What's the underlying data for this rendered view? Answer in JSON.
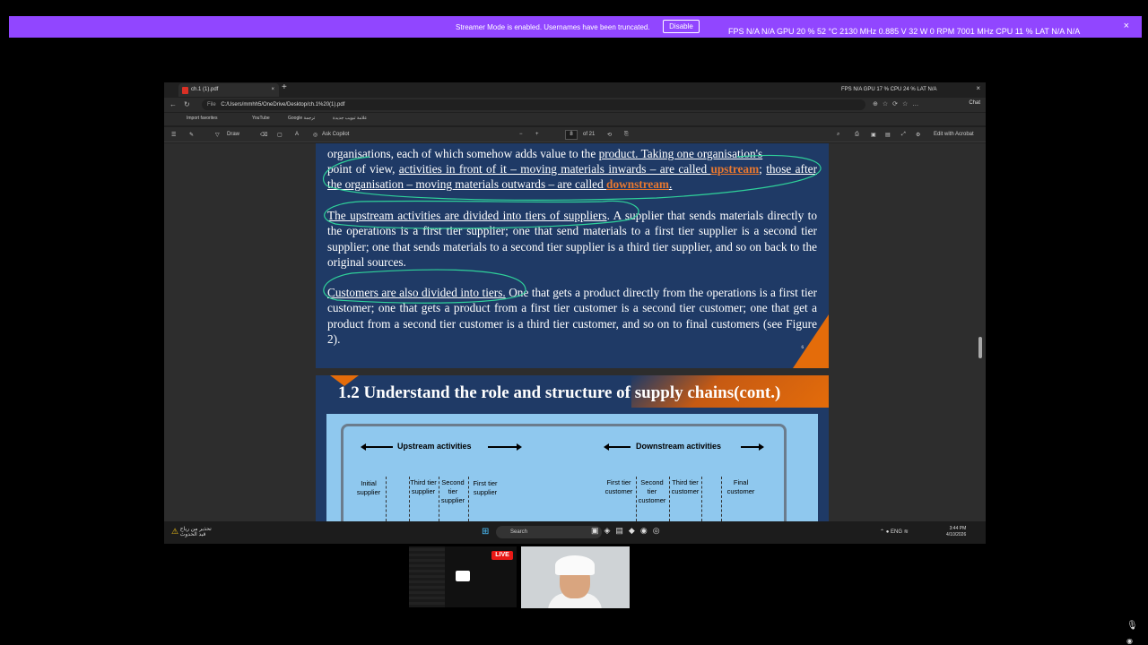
{
  "banner": {
    "message": "Streamer Mode is enabled. Usernames have been truncated.",
    "disable_label": "Disable",
    "stats": "FPS N/A N/A    GPU 20 % 52 °C 2130 MHz 0.885 V 32 W 0 RPM 7001 MHz    CPU 11 %    LAT N/A N/A",
    "close": "×"
  },
  "browser": {
    "tab_title": "ch.1 (1).pdf",
    "tab_close": "×",
    "new_tab": "+",
    "window_stats": "FPS N/A   GPU 17 %   CPU 24 %   LAT N/A",
    "window_close": "×",
    "url_label": "File",
    "url": "C:/Users/mmhh5/OneDrive/Desktop/ch.1%20(1).pdf",
    "chat_label": "Chat",
    "favorites": [
      "Import favorites",
      "YouTube",
      "Google ترجمة",
      "علامة تبويب جديدة"
    ]
  },
  "pdf_toolbar": {
    "draw": "Draw",
    "ask_copilot": "Ask Copilot",
    "zoom_out": "−",
    "zoom_in": "+",
    "page_current": "8",
    "page_total": "of 21",
    "edit_acrobat": "Edit with Acrobat"
  },
  "slide1": {
    "line0_pre": "organisations, each of which somehow adds value to the ",
    "line0_product": "product. Taking one organisation's",
    "p1_pre": "point of view, ",
    "p1_u1": "activities in front of it – moving materials inwards – are called ",
    "p1_upstream": "upstream",
    "p1_sep": "; ",
    "p1_u2": "those after the organisation – moving materials outwards – are called ",
    "p1_downstream": "downstream",
    "p1_end": ".",
    "p2_u": "The upstream activities are divided into tiers of suppliers",
    "p2_rest": ". A supplier that sends materials directly to the operations is a first tier supplier; one that send materials to a first tier supplier is a second tier supplier; one that sends materials to a second tier supplier is a third tier supplier, and so on back to the original sources.",
    "p3_u": "Customers are also divided into tiers.",
    "p3_rest": " One that gets a product directly from the operations is a first tier customer; one that gets a product from a first tier customer is a second tier customer; one that get a product from a second tier customer is a third tier customer, and so on to final customers (see Figure 2).",
    "page_num": "6"
  },
  "slide2": {
    "title": "1.2 Understand the role  and structure of supply chains(cont.)",
    "upstream_label": "Upstream activities",
    "downstream_label": "Downstream activities",
    "tiers": [
      "Initial supplier",
      "Third tier supplier",
      "Second tier supplier",
      "First tier supplier",
      "First tier customer",
      "Second tier customer",
      "Third tier customer",
      "Final customer"
    ]
  },
  "taskbar": {
    "weather_line1": "تحذير من رياح",
    "weather_line2": "قيد الحدوث",
    "search_placeholder": "Search",
    "lang": "ENG",
    "time": "3:44 PM",
    "date": "4/10/2026"
  },
  "overlay": {
    "live_label": "LIVE"
  }
}
